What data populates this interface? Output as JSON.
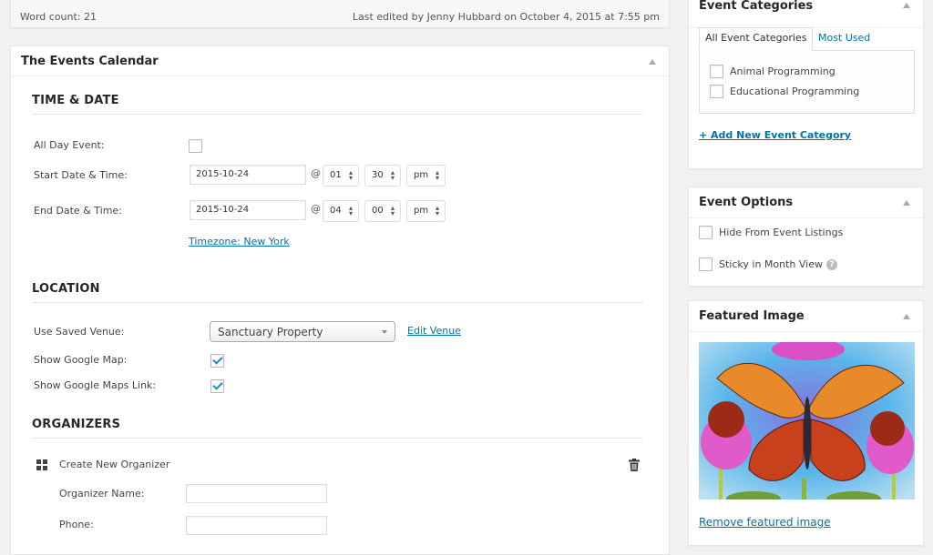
{
  "status_bar": {
    "word_count": "Word count: 21",
    "last_edited": "Last edited by Jenny Hubbard on October 4, 2015 at 7:55 pm"
  },
  "events_calendar": {
    "title": "The Events Calendar",
    "time_date": {
      "heading": "TIME & DATE",
      "all_day_label": "All Day Event:",
      "all_day_checked": false,
      "start_label": "Start Date & Time:",
      "start_date": "2015-10-24",
      "start_hour": "01",
      "start_minute": "30",
      "start_meridian": "pm",
      "end_label": "End Date & Time:",
      "end_date": "2015-10-24",
      "end_hour": "04",
      "end_minute": "00",
      "end_meridian": "pm",
      "at_symbol": "@",
      "timezone_link": "Timezone: New York"
    },
    "location": {
      "heading": "LOCATION",
      "venue_label": "Use Saved Venue:",
      "venue_value": "Sanctuary Property",
      "edit_venue": "Edit Venue",
      "show_map_label": "Show Google Map:",
      "show_map_checked": true,
      "show_map_link_label": "Show Google Maps Link:",
      "show_map_link_checked": true
    },
    "organizers": {
      "heading": "ORGANIZERS",
      "create_new": "Create New Organizer",
      "name_label": "Organizer Name:",
      "name_value": "",
      "phone_label": "Phone:",
      "phone_value": ""
    }
  },
  "event_categories": {
    "title": "Event Categories",
    "tabs": [
      "All Event Categories",
      "Most Used"
    ],
    "items": [
      {
        "label": "Animal Programming",
        "checked": false
      },
      {
        "label": "Educational Programming",
        "checked": false
      }
    ],
    "add_link": "+ Add New Event Category"
  },
  "event_options": {
    "title": "Event Options",
    "items": [
      {
        "label": "Hide From Event Listings",
        "checked": false
      },
      {
        "label": "Sticky in Month View",
        "checked": false,
        "help": "?"
      }
    ]
  },
  "featured_image": {
    "title": "Featured Image",
    "image_alt": "Watercolor painting of a butterfly made of autumn oak leaves among pink coneflowers",
    "remove_link": "Remove featured image"
  },
  "colors": {
    "link": "#0073aa",
    "checkmark": "#1e8cbe",
    "background": "#f1f1f1"
  }
}
